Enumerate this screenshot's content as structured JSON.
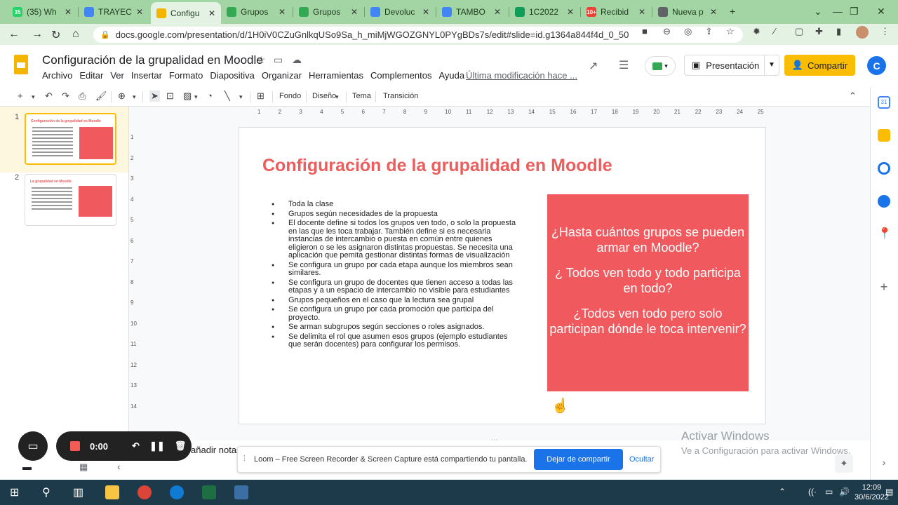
{
  "browser": {
    "tabs": [
      {
        "label": "(35) Wh",
        "fav_color": "#25d366",
        "fav_text": "35"
      },
      {
        "label": "TRAYEC",
        "fav_color": "#4285f4",
        "fav_text": ""
      },
      {
        "label": "Configu",
        "fav_color": "#f4b400",
        "fav_text": "",
        "active": true
      },
      {
        "label": "Grupos",
        "fav_color": "#34a853",
        "fav_text": ""
      },
      {
        "label": "Grupos",
        "fav_color": "#34a853",
        "fav_text": ""
      },
      {
        "label": "Devoluc",
        "fav_color": "#4285f4",
        "fav_text": ""
      },
      {
        "label": "TAMBO",
        "fav_color": "#4285f4",
        "fav_text": ""
      },
      {
        "label": "1C2022",
        "fav_color": "#0f9d58",
        "fav_text": ""
      },
      {
        "label": "Recibid",
        "fav_color": "#ea4335",
        "fav_text": "10+"
      },
      {
        "label": "Nueva p",
        "fav_color": "#5f6368",
        "fav_text": ""
      }
    ],
    "url": "docs.google.com/presentation/d/1H0iV0CZuGnlkqUSo9Sa_h_miMjWGOZGNYL0PYgBDs7s/edit#slide=id.g1364a844f4d_0_50"
  },
  "docs": {
    "title": "Configuración de la grupalidad en Moodle",
    "menu": [
      "Archivo",
      "Editar",
      "Ver",
      "Insertar",
      "Formato",
      "Diapositiva",
      "Organizar",
      "Herramientas",
      "Complementos",
      "Ayuda"
    ],
    "last_modified": "Última modificación hace ...",
    "present_label": "Presentación",
    "share_label": "Compartir",
    "avatar_letter": "C"
  },
  "toolbar": {
    "fondo": "Fondo",
    "diseno": "Diseño",
    "tema": "Tema",
    "transicion": "Transición"
  },
  "ruler": {
    "h_labels": [
      "1",
      "2",
      "3",
      "4",
      "5",
      "6",
      "7",
      "8",
      "9",
      "10",
      "11",
      "12",
      "13",
      "14",
      "15",
      "16",
      "17",
      "18",
      "19",
      "20",
      "21",
      "22",
      "23",
      "24",
      "25"
    ],
    "v_labels": [
      "1",
      "2",
      "3",
      "4",
      "5",
      "6",
      "7",
      "8",
      "9",
      "10",
      "11",
      "12",
      "13",
      "14"
    ]
  },
  "filmstrip": {
    "slides": [
      {
        "num": "1",
        "title": "Configuración de la grupalidad en Moodle"
      },
      {
        "num": "2",
        "title": "La grupalidad en Moodle"
      }
    ]
  },
  "slide": {
    "title": "Configuración de la grupalidad en Moodle",
    "bullets": [
      "Toda la clase",
      "Grupos según necesidades de la propuesta",
      "El docente define si todos los grupos ven todo, o solo la propuesta en las que les toca trabajar. También define si es necesaria  instancias de intercambio  o puesta en común entre quienes eligieron o se les asignaron distintas propuestas. Se necesita una aplicación que pemita gestionar distintas formas de visualización",
      "Se configura un grupo por cada etapa aunque los miembros sean similares.",
      "Se configura un grupo de docentes que tienen acceso a todas las etapas y a un espacio de intercambio no visible para estudiantes",
      "Grupos pequeños en el caso que la lectura sea grupal",
      "Se configura un grupo por cada promoción que participa del proyecto.",
      "Se arman subgrupos según secciones o roles asignados.",
      "Se delimita el rol que asumen esos grupos (ejemplo estudiantes que serán docentes) para configurar los permisos."
    ],
    "questions": [
      "¿Hasta cuántos grupos se pueden armar en Moodle?",
      "¿ Todos ven todo y todo participa en todo?",
      "¿Todos ven todo pero solo participan dónde le toca intervenir?"
    ]
  },
  "notes": {
    "text": "añadir notas del orador"
  },
  "loom": {
    "timer": "0:00",
    "share_text": "Loom – Free Screen Recorder & Screen Capture está compartiendo tu pantalla.",
    "stop_label": "Dejar de compartir",
    "hide_label": "Ocultar"
  },
  "watermark": {
    "line1": "Activar Windows",
    "line2": "Ve a Configuración para activar Windows."
  },
  "taskbar": {
    "time": "12:09",
    "date": "30/6/2022"
  }
}
